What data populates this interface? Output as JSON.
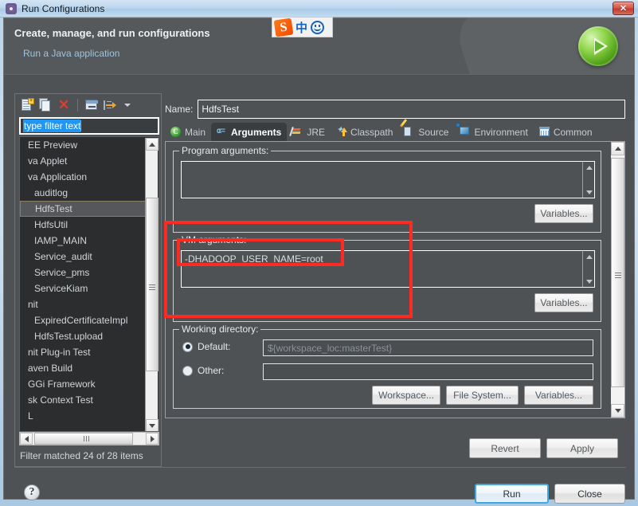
{
  "window": {
    "title": "Run Configurations",
    "title_icon": "run-configurations-icon",
    "close_label": "✕"
  },
  "banner": {
    "title": "Create, manage, and run configurations",
    "subtitle": "Run a Java application",
    "icon": "green-run-play-icon"
  },
  "ime": {
    "logo": "S",
    "mode": "中",
    "smiley": "smiley-icon"
  },
  "sidebar": {
    "toolbar": [
      {
        "name": "new-configuration-icon",
        "label": "New launch configuration"
      },
      {
        "name": "duplicate-configuration-icon",
        "label": "Duplicate"
      },
      {
        "name": "delete-configuration-icon",
        "label": "Delete"
      },
      {
        "name": "collapse-all-icon",
        "label": "Collapse All"
      },
      {
        "name": "filter-icon",
        "label": "Filter"
      },
      {
        "name": "chevron-down-icon",
        "label": "View Menu"
      }
    ],
    "filter": {
      "value": "type filter text",
      "placeholder": "type filter text",
      "selected": true
    },
    "items": [
      {
        "label": "EE Preview",
        "indent": false,
        "selected": false
      },
      {
        "label": "va Applet",
        "indent": false,
        "selected": false
      },
      {
        "label": "va Application",
        "indent": false,
        "selected": false
      },
      {
        "label": "auditlog",
        "indent": true,
        "selected": false
      },
      {
        "label": "HdfsTest",
        "indent": true,
        "selected": true
      },
      {
        "label": "HdfsUtil",
        "indent": true,
        "selected": false
      },
      {
        "label": "IAMP_MAIN",
        "indent": true,
        "selected": false
      },
      {
        "label": "Service_audit",
        "indent": true,
        "selected": false
      },
      {
        "label": "Service_pms",
        "indent": true,
        "selected": false
      },
      {
        "label": "ServiceKiam",
        "indent": true,
        "selected": false
      },
      {
        "label": "nit",
        "indent": false,
        "selected": false
      },
      {
        "label": "ExpiredCertificateImpl",
        "indent": true,
        "selected": false
      },
      {
        "label": "HdfsTest.upload",
        "indent": true,
        "selected": false
      },
      {
        "label": "nit Plug-in Test",
        "indent": false,
        "selected": false
      },
      {
        "label": "aven Build",
        "indent": false,
        "selected": false
      },
      {
        "label": "GGi Framework",
        "indent": false,
        "selected": false
      },
      {
        "label": "sk Context Test",
        "indent": false,
        "selected": false
      },
      {
        "label": "L",
        "indent": false,
        "selected": false
      }
    ],
    "status": "Filter matched 24 of 28 items"
  },
  "main": {
    "name_label": "Name:",
    "name_value": "HdfsTest",
    "tabs": [
      {
        "label": "Main",
        "icon": "main-tab-icon",
        "active": false
      },
      {
        "label": "Arguments",
        "icon": "arguments-tab-icon",
        "active": true
      },
      {
        "label": "JRE",
        "icon": "jre-tab-icon",
        "active": false
      },
      {
        "label": "Classpath",
        "icon": "classpath-tab-icon",
        "active": false
      },
      {
        "label": "Source",
        "icon": "source-tab-icon",
        "active": false
      },
      {
        "label": "Environment",
        "icon": "environment-tab-icon",
        "active": false
      },
      {
        "label": "Common",
        "icon": "common-tab-icon",
        "active": false
      }
    ],
    "program_arguments": {
      "legend": "Program arguments:",
      "value": "",
      "variables_button": "Variables..."
    },
    "vm_arguments": {
      "legend": "VM arguments:",
      "value": "-DHADOOP_USER_NAME=root",
      "variables_button": "Variables..."
    },
    "working_directory": {
      "legend": "Working directory:",
      "default_label": "Default:",
      "default_value": "${workspace_loc:masterTest}",
      "default_selected": true,
      "other_label": "Other:",
      "other_value": "",
      "other_selected": false,
      "workspace_button": "Workspace...",
      "file_system_button": "File System...",
      "variables_button": "Variables..."
    }
  },
  "footer": {
    "revert_button": "Revert",
    "apply_button": "Apply",
    "help_icon": "help-icon",
    "run_button": "Run",
    "close_button": "Close"
  },
  "colors": {
    "accent_blue": "#3fa9e0",
    "annotation_red": "#ff2b22",
    "dialog_bg": "#4e5255",
    "list_bg": "#2b2d2f",
    "link_blue": "#9dc4e0"
  }
}
